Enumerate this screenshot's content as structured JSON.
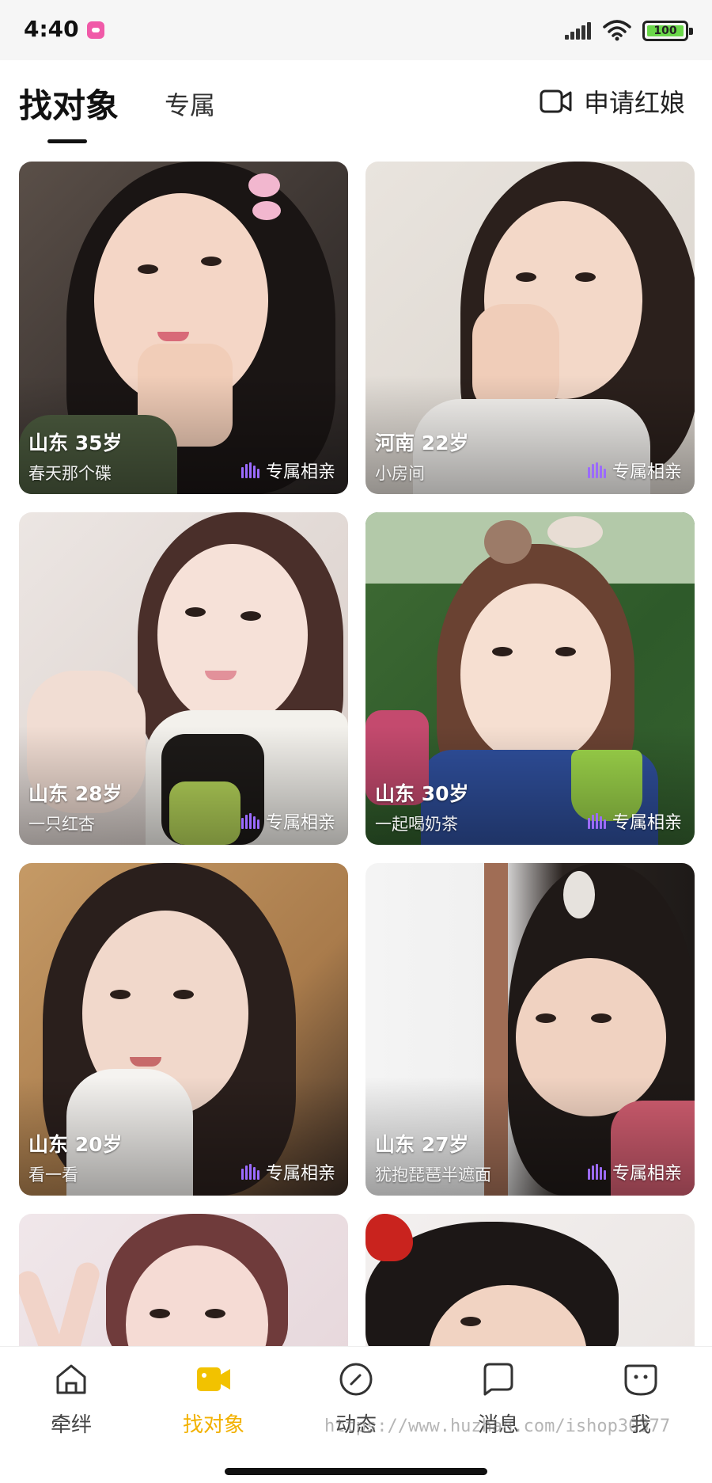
{
  "status_bar": {
    "time": "4:40",
    "battery": "100",
    "icons": [
      "app-badge-icon",
      "signal-icon",
      "wifi-icon",
      "battery-icon"
    ]
  },
  "header": {
    "tabs": [
      {
        "label": "找对象",
        "active": true
      },
      {
        "label": "专属",
        "active": false
      }
    ],
    "matchmaker_button": {
      "label": "申请红娘",
      "icon": "video-camera-icon"
    }
  },
  "cards": [
    {
      "title": "山东 35岁",
      "subtitle": "春天那个碟",
      "tag": "专属相亲",
      "tag_icon": "audio-bars-icon"
    },
    {
      "title": "河南 22岁",
      "subtitle": "小房间",
      "tag": "专属相亲",
      "tag_icon": "audio-bars-icon"
    },
    {
      "title": "山东 28岁",
      "subtitle": "一只红杏",
      "tag": "专属相亲",
      "tag_icon": "audio-bars-icon"
    },
    {
      "title": "山东 30岁",
      "subtitle": "一起喝奶茶",
      "tag": "专属相亲",
      "tag_icon": "audio-bars-icon"
    },
    {
      "title": "山东 20岁",
      "subtitle": "看一看",
      "tag": "专属相亲",
      "tag_icon": "audio-bars-icon"
    },
    {
      "title": "山东 27岁",
      "subtitle": "犹抱琵琶半遮面",
      "tag": "专属相亲",
      "tag_icon": "audio-bars-icon"
    }
  ],
  "tabbar": {
    "items": [
      {
        "label": "牵绊",
        "icon": "home-icon",
        "active": false
      },
      {
        "label": "找对象",
        "icon": "video-camera-icon",
        "active": true
      },
      {
        "label": "动态",
        "icon": "compass-icon",
        "active": false
      },
      {
        "label": "消息",
        "icon": "chat-bubble-icon",
        "active": false
      },
      {
        "label": "我",
        "icon": "face-icon",
        "active": false
      }
    ],
    "watermark": "https://www.huzhan.com/ishop30377"
  },
  "colors": {
    "accent": "#f2b100",
    "tag_bars": "#9b6bff",
    "battery_fill": "#6bd84a"
  }
}
